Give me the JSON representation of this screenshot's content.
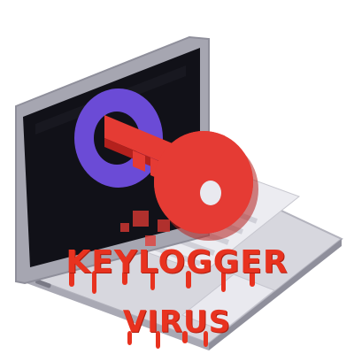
{
  "illustration": {
    "subject": "laptop-with-key-in-screen",
    "colors": {
      "laptop_body": "#d9d9e0",
      "laptop_edge": "#a7a7b3",
      "screen": "#111118",
      "keyhole": "#6b4bd6",
      "key": "#e53b34",
      "key_shadow": "#b4211d",
      "title_red": "#e8321f"
    }
  },
  "title": {
    "line1": "KEYLOGGER",
    "line2": "VIRUS"
  }
}
